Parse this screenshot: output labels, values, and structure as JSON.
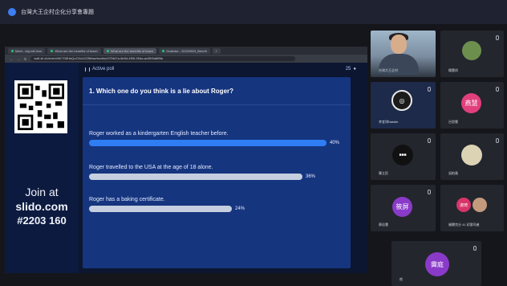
{
  "app": {
    "title": "台灣大王企村企化分享會專題"
  },
  "browser": {
    "tabs": [
      {
        "label": "Meet - bqi-vdf-hvm"
      },
      {
        "label": "What are the benefits of teach"
      },
      {
        "label": "What are the benefits of teach"
      },
      {
        "label": "Onslidse - 20220603_Benefi"
      }
    ],
    "url": "wall.sli.do/event/bK7G8HaQoCKuU2ZfMaw/section/37f4d7a-8e5d-4f06-95da-ac0fb9a6f8fa"
  },
  "slido": {
    "join_label": "Join at",
    "host": "slido.com",
    "code": "#2203 160",
    "poll_label": "Active poll",
    "participants": "25",
    "question": "1. Which one do you think is a lie about Roger?",
    "options": [
      {
        "text": "Roger worked as a kindergarten English teacher before.",
        "pct_label": "40%",
        "value": 0.4
      },
      {
        "text": "Roger travelled to the USA at the age of 18 alone.",
        "pct_label": "36%",
        "value": 0.36
      },
      {
        "text": "Roger has a baking certificate.",
        "pct_label": "24%",
        "value": 0.24
      }
    ]
  },
  "participants": [
    {
      "name": "台灣大王企村",
      "initials": ""
    },
    {
      "name": "楊雲尚",
      "initials": ""
    },
    {
      "name": "李宜琪Natalie",
      "initials": ""
    },
    {
      "name": "呂思雲",
      "initials": "燕慧"
    },
    {
      "name": "陳立民",
      "initials": ""
    },
    {
      "name": "吳柏堯",
      "initials": ""
    },
    {
      "name": "蔡佳慧",
      "initials": "筱屏"
    },
    {
      "name": "福爾克分 41 初發司者",
      "initials": "淑琦"
    },
    {
      "name": "他",
      "initials": "霽庭"
    }
  ],
  "colors": {
    "bar_top": "#2f7df3",
    "bar_other": "#c6cfdf",
    "card": "#16357f",
    "accent_pink": "#e1407d",
    "accent_purple": "#8a3ac8"
  }
}
